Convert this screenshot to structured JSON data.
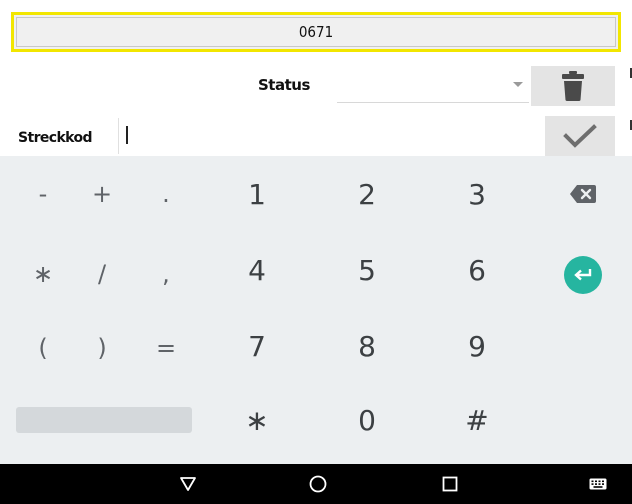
{
  "header": {
    "order_number": "0671"
  },
  "form": {
    "status_label": "Status",
    "status_value": "",
    "barcode_label": "Streckkod",
    "barcode_value": ""
  },
  "keyboard": {
    "row1": {
      "s1": "-",
      "s2": "+",
      "s3": ".",
      "d1": "1",
      "d2": "2",
      "d3": "3"
    },
    "row2": {
      "s1": "∗",
      "s2": "/",
      "s3": ",",
      "d1": "4",
      "d2": "5",
      "d3": "6"
    },
    "row3": {
      "s1": "(",
      "s2": ")",
      "s3": "=",
      "d1": "7",
      "d2": "8",
      "d3": "9"
    },
    "row4": {
      "d1": "∗",
      "d2": "0",
      "d3": "#"
    },
    "backspace_icon": "backspace-icon",
    "enter_icon": "enter-icon"
  },
  "navbar": {
    "back_icon": "back-triangle-icon",
    "home_icon": "home-circle-icon",
    "recents_icon": "recents-square-icon",
    "keyboard_icon": "keyboard-icon"
  },
  "colors": {
    "header_border": "#f2e600",
    "enter_key": "#26b5a0",
    "keyboard_bg": "#eceff1"
  }
}
